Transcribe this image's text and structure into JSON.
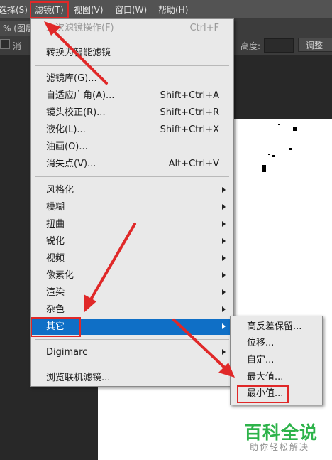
{
  "menubar": {
    "items": [
      "选择(S)",
      "滤镜(T)",
      "视图(V)",
      "窗口(W)",
      "帮助(H)"
    ]
  },
  "document": {
    "tab_label": "% (图层",
    "option_label_1": "消",
    "height_label": "高度:",
    "adjust_button": "调整"
  },
  "filter_menu": {
    "items": [
      {
        "label": "上次滤镜操作(F)",
        "shortcut": "Ctrl+F",
        "disabled": true
      },
      {
        "label": "转换为智能滤镜",
        "shortcut": ""
      },
      {
        "label": "滤镜库(G)...",
        "shortcut": ""
      },
      {
        "label": "自适应广角(A)...",
        "shortcut": "Shift+Ctrl+A"
      },
      {
        "label": "镜头校正(R)...",
        "shortcut": "Shift+Ctrl+R"
      },
      {
        "label": "液化(L)...",
        "shortcut": "Shift+Ctrl+X"
      },
      {
        "label": "油画(O)...",
        "shortcut": ""
      },
      {
        "label": "消失点(V)...",
        "shortcut": "Alt+Ctrl+V"
      },
      {
        "label": "风格化",
        "submenu": true
      },
      {
        "label": "模糊",
        "submenu": true
      },
      {
        "label": "扭曲",
        "submenu": true
      },
      {
        "label": "锐化",
        "submenu": true
      },
      {
        "label": "视频",
        "submenu": true
      },
      {
        "label": "像素化",
        "submenu": true
      },
      {
        "label": "渲染",
        "submenu": true
      },
      {
        "label": "杂色",
        "submenu": true
      },
      {
        "label": "其它",
        "submenu": true,
        "highlighted": true
      },
      {
        "label": "Digimarc",
        "submenu": true
      },
      {
        "label": "浏览联机滤镜...",
        "shortcut": ""
      }
    ]
  },
  "other_submenu": {
    "items": [
      "高反差保留...",
      "位移...",
      "自定...",
      "最大值...",
      "最小值..."
    ]
  },
  "watermark": {
    "logo": "百科全说",
    "subtitle": "助你轻松解决"
  },
  "colors": {
    "highlight": "#0f6fc6",
    "annotation_red": "#e02828",
    "watermark_green": "#2db34a"
  }
}
